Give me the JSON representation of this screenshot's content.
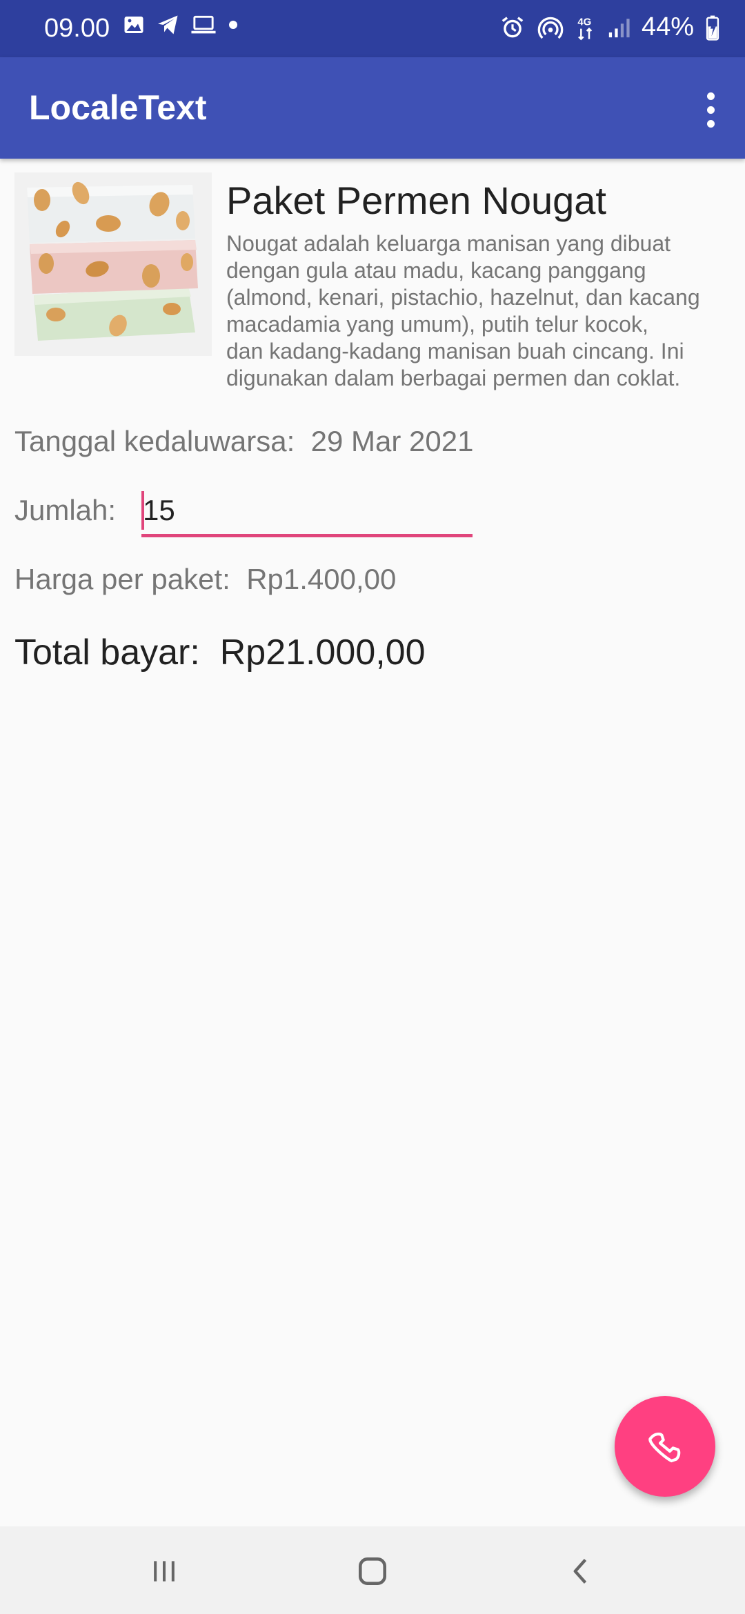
{
  "status_bar": {
    "time": "09.00",
    "battery": "44%",
    "network": "4G",
    "icons": [
      "image-icon",
      "telegram-icon",
      "laptop-icon",
      "dot-icon",
      "alarm-icon",
      "hotspot-icon",
      "network-4g-icon",
      "signal-icon",
      "battery-charging-icon"
    ]
  },
  "app_bar": {
    "title": "LocaleText",
    "menu_icon": "more-vert-icon"
  },
  "product": {
    "title": "Paket Permen Nougat",
    "description": "Nougat adalah keluarga manisan yang dibuat\ndengan gula atau madu, kacang panggang\n(almond, kenari, pistachio, hazelnut, dan kacang\nmacadamia yang umum), putih telur kocok,\ndan kadang-kadang manisan buah cincang. Ini\ndigunakan dalam berbagai permen dan coklat.",
    "image": "nougat-candy-image"
  },
  "details": {
    "expiry_label": "Tanggal kedaluwarsa:",
    "expiry_value": "29 Mar 2021",
    "quantity_label": "Jumlah:",
    "quantity_value": "15",
    "price_label": "Harga per paket:",
    "price_value": "Rp1.400,00",
    "total_label": "Total bayar:",
    "total_value": "Rp21.000,00"
  },
  "fab": {
    "icon": "phone-icon"
  },
  "nav_bar": {
    "icons": [
      "recent-apps-icon",
      "home-icon",
      "back-icon"
    ]
  },
  "colors": {
    "status_bar": "#2e3f9e",
    "app_bar": "#3f51b5",
    "accent": "#ff4081",
    "input_underline": "#e0457b"
  }
}
